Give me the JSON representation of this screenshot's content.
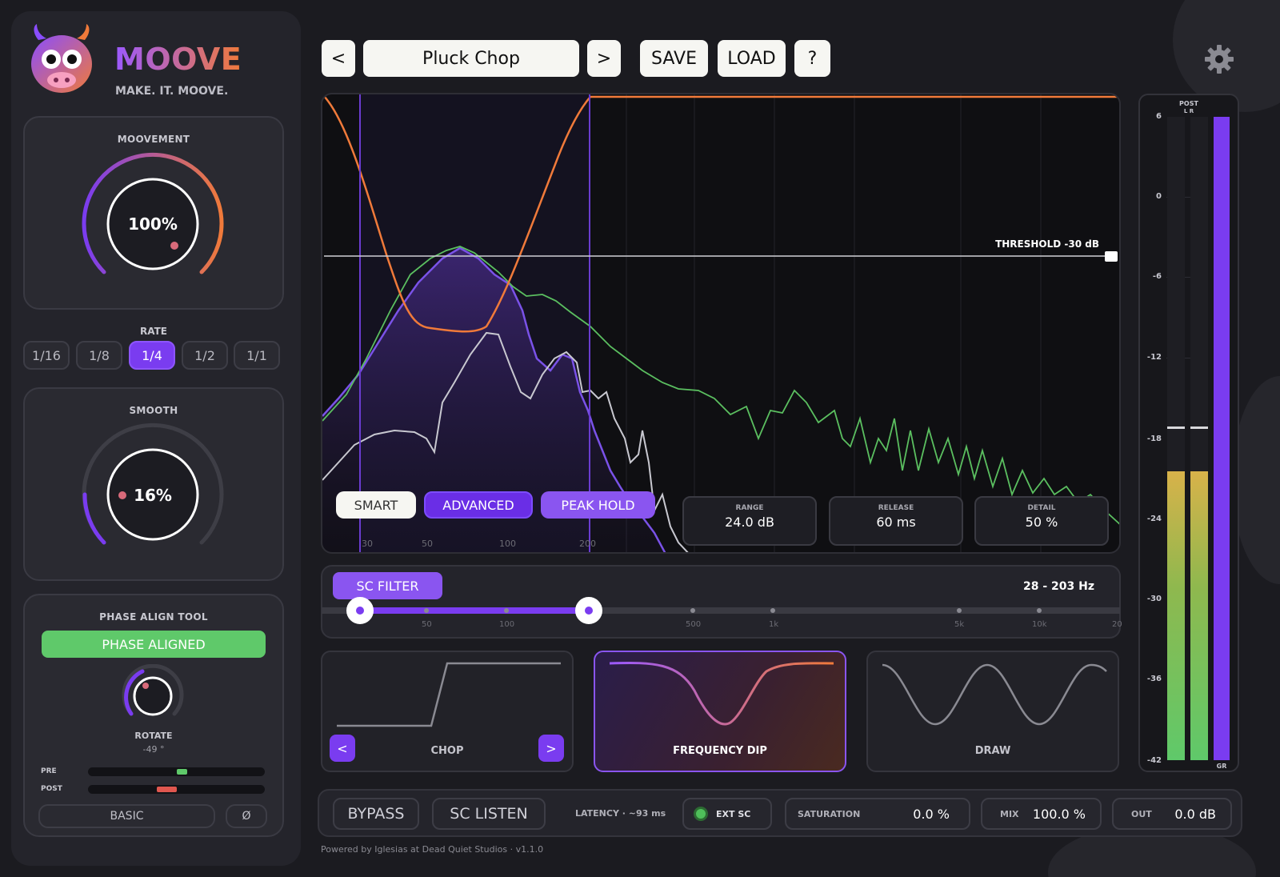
{
  "brand": {
    "name": "MOOVE",
    "tagline": "MAKE. IT. MOOVE."
  },
  "movement": {
    "title": "MOOVEMENT",
    "value": "100%"
  },
  "rate": {
    "title": "RATE",
    "options": [
      "1/16",
      "1/8",
      "1/4",
      "1/2",
      "1/1"
    ],
    "selected": "1/4"
  },
  "smooth": {
    "title": "SMOOTH",
    "value": "16%"
  },
  "phase": {
    "title": "PHASE ALIGN TOOL",
    "status": "PHASE ALIGNED",
    "rotate_label": "ROTATE",
    "rotate_value": "-49 °",
    "pre_label": "PRE",
    "post_label": "POST",
    "basic_label": "BASIC",
    "polarity_label": "Ø"
  },
  "preset": {
    "prev": "<",
    "name": "Pluck Chop",
    "next": ">",
    "save": "SAVE",
    "load": "LOAD",
    "help": "?"
  },
  "analyzer": {
    "threshold_label": "THRESHOLD  -30 dB",
    "modes": [
      "SMART",
      "ADVANCED",
      "PEAK HOLD"
    ],
    "freq_labels": [
      "30",
      "50",
      "100",
      "200"
    ],
    "range": {
      "label": "RANGE",
      "value": "24.0 dB"
    },
    "release": {
      "label": "RELEASE",
      "value": "60 ms"
    },
    "detail": {
      "label": "DETAIL",
      "value": "50 %"
    }
  },
  "sc_filter": {
    "button": "SC FILTER",
    "range": "28 - 203 Hz",
    "labels": [
      "50",
      "100",
      "500",
      "1k",
      "5k",
      "10k",
      "20"
    ]
  },
  "shapes": {
    "chop": "CHOP",
    "freq_dip": "FREQUENCY DIP",
    "draw": "DRAW",
    "prev": "<",
    "next": ">"
  },
  "meter": {
    "title": "POST",
    "lr": "L R",
    "gr": "GR",
    "db_labels": [
      "6",
      "0",
      "-6",
      "-12",
      "-18",
      "-24",
      "-30",
      "-36",
      "-42"
    ]
  },
  "bottom": {
    "bypass": "BYPASS",
    "sc_listen": "SC LISTEN",
    "latency": "LATENCY  ·  ~93 ms",
    "ext_sc": "EXT SC",
    "saturation": {
      "label": "SATURATION",
      "value": "0.0 %"
    },
    "mix": {
      "label": "MIX",
      "value": "100.0 %"
    },
    "out": {
      "label": "OUT",
      "value": "0.0 dB"
    }
  },
  "footer": "Powered by Iglesias at Dead Quiet Studios  ·  v1.1.0",
  "colors": {
    "accent": "#7a3cf0",
    "orange": "#f07a3a",
    "green": "#5fc96a",
    "background": "#1b1b20"
  }
}
